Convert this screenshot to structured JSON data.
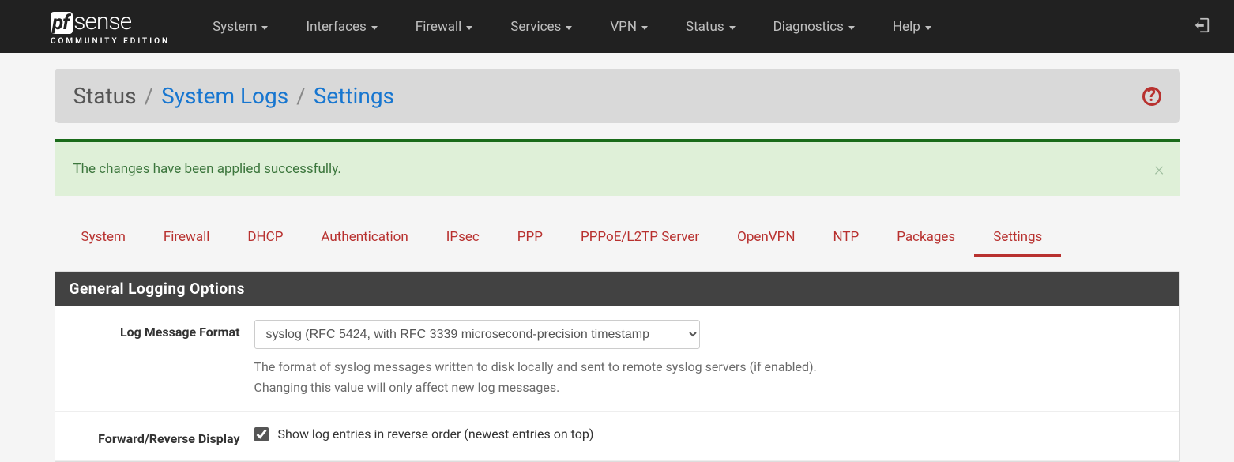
{
  "logo": {
    "box": "pf",
    "text": "sense",
    "sub": "COMMUNITY EDITION"
  },
  "nav": [
    {
      "label": "System"
    },
    {
      "label": "Interfaces"
    },
    {
      "label": "Firewall"
    },
    {
      "label": "Services"
    },
    {
      "label": "VPN"
    },
    {
      "label": "Status"
    },
    {
      "label": "Diagnostics"
    },
    {
      "label": "Help"
    }
  ],
  "breadcrumb": {
    "root": "Status",
    "mid": "System Logs",
    "leaf": "Settings"
  },
  "alert": {
    "text": "The changes have been applied successfully."
  },
  "tabs": [
    "System",
    "Firewall",
    "DHCP",
    "Authentication",
    "IPsec",
    "PPP",
    "PPPoE/L2TP Server",
    "OpenVPN",
    "NTP",
    "Packages",
    "Settings"
  ],
  "active_tab": "Settings",
  "panel": {
    "title": "General Logging Options",
    "rows": {
      "log_format": {
        "label": "Log Message Format",
        "selected": "syslog (RFC 5424, with RFC 3339 microsecond-precision timestamp",
        "help1": "The format of syslog messages written to disk locally and sent to remote syslog servers (if enabled).",
        "help2": "Changing this value will only affect new log messages."
      },
      "reverse": {
        "label": "Forward/Reverse Display",
        "checkbox_label": "Show log entries in reverse order (newest entries on top)",
        "checked": true
      }
    }
  }
}
